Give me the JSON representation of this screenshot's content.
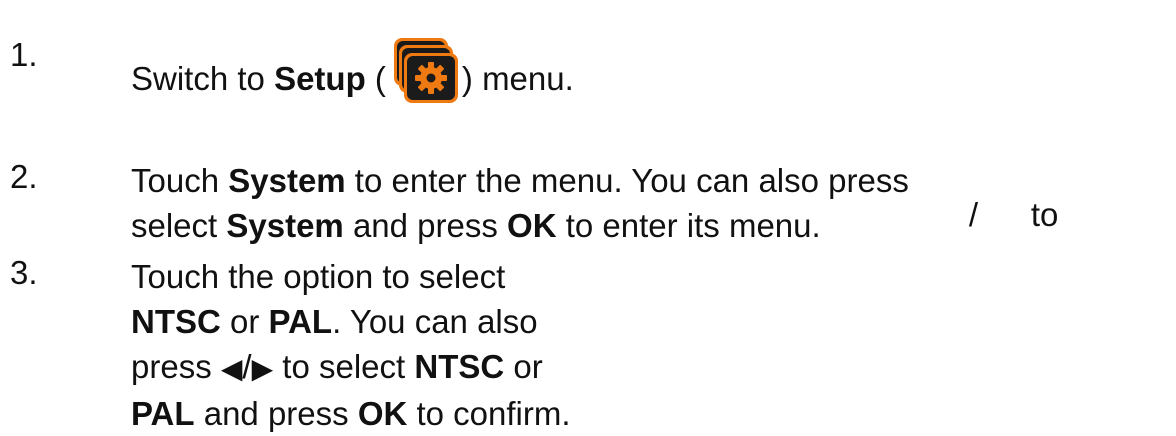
{
  "steps": [
    {
      "number": "1.",
      "pre": "Switch to ",
      "bold1": "Setup",
      "mid": " (",
      "icon": "gear-setup-icon",
      "post": ") menu."
    },
    {
      "number": "2.",
      "line1_pre": "Touch ",
      "line1_bold": "System",
      "line1_post": " to enter the menu. You can also press",
      "slash": "/",
      "line1_to": "to",
      "line2_pre": "select ",
      "line2_bold1": "System",
      "line2_mid": " and press ",
      "line2_bold2": "OK",
      "line2_post": " to enter its menu."
    },
    {
      "number": "3.",
      "l1": "Touch the option to select",
      "l2_b1": "NTSC",
      "l2_mid": " or ",
      "l2_b2": "PAL",
      "l2_post": ". You can also",
      "l3_pre": "press ",
      "l3_left_arrow": "◀",
      "l3_slash": "/",
      "l3_right_arrow": "▶",
      "l3_mid": " to select ",
      "l3_b": "NTSC",
      "l3_post": " or",
      "l4_b1": "PAL",
      "l4_mid": " and press ",
      "l4_b2": "OK",
      "l4_post": " to confirm."
    }
  ],
  "colors": {
    "icon_orange": "#f07a12",
    "icon_dark": "#1a1a1a",
    "text": "#111111"
  }
}
